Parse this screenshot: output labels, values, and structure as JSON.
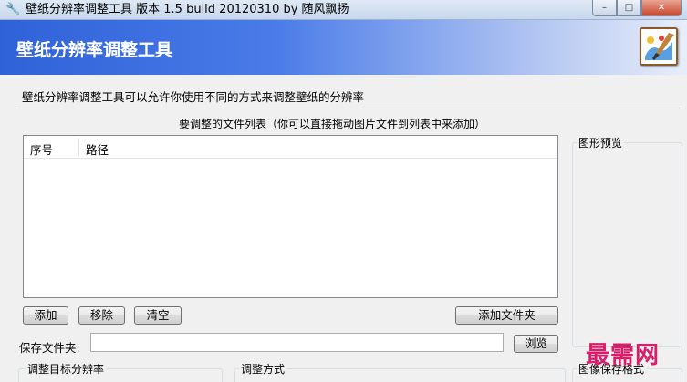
{
  "window": {
    "title": "壁纸分辨率调整工具 版本 1.5 build 20120310 by 随风飘扬",
    "minimize": "–",
    "maximize": "□",
    "close": "✕"
  },
  "banner": {
    "title": "壁纸分辨率调整工具",
    "icon": "paint-palette-icon"
  },
  "description": "壁纸分辨率调整工具可以允许你使用不同的方式来调整壁纸的分辨率",
  "file_list": {
    "caption": "要调整的文件列表（你可以直接拖动图片文件到列表中来添加）",
    "columns": [
      "序号",
      "路径"
    ],
    "rows": []
  },
  "preview": {
    "label": "图形预览"
  },
  "buttons": {
    "add": "添加",
    "remove": "移除",
    "clear": "清空",
    "add_folder": "添加文件夹",
    "browse": "浏览"
  },
  "save_folder": {
    "label": "保存文件夹:",
    "value": ""
  },
  "groups": {
    "target_resolution": "调整目标分辨率",
    "method": "调整方式",
    "save_format": "图像保存格式"
  },
  "watermark": "最需网",
  "colors": {
    "banner_start": "#2f62d8",
    "banner_end": "#e8eef9",
    "watermark": "#d81e6a"
  }
}
